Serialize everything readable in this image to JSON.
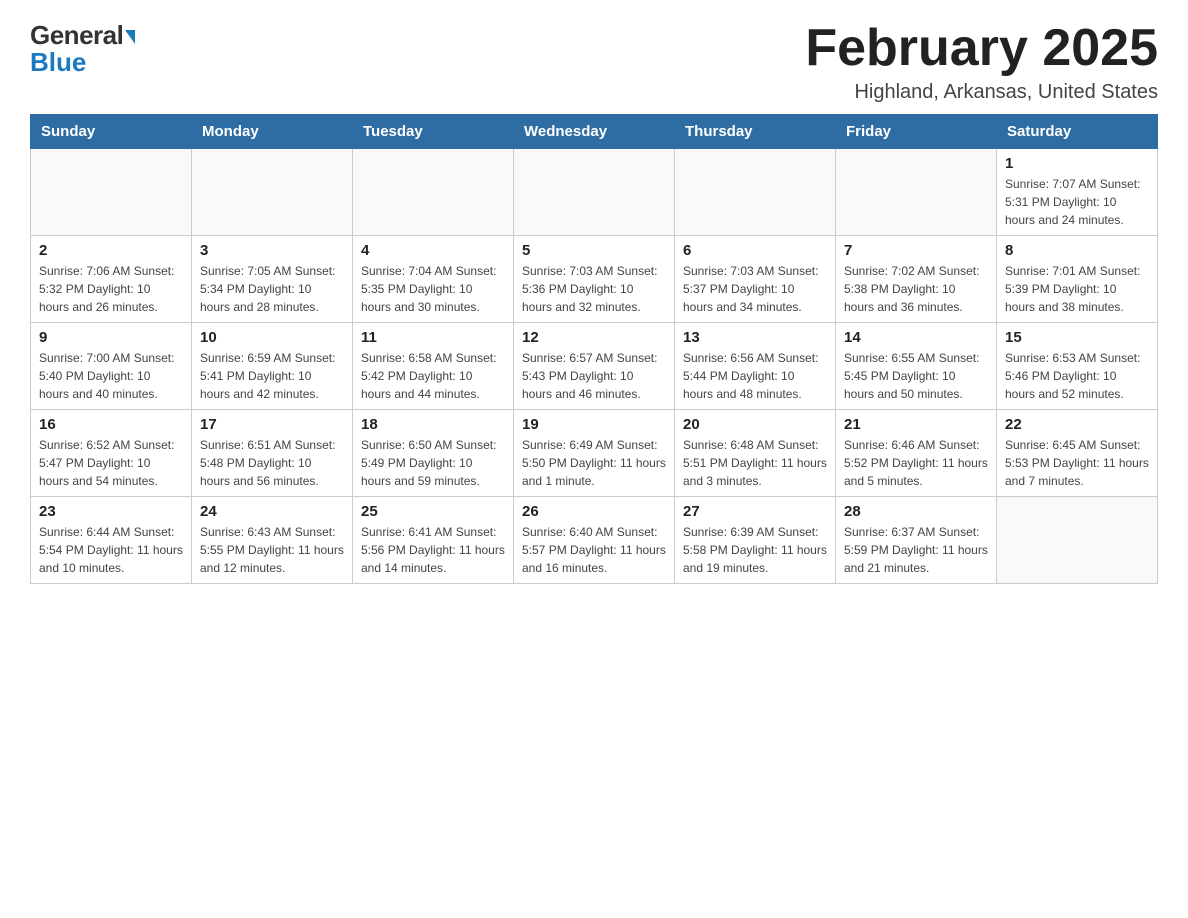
{
  "header": {
    "logo_general": "General",
    "logo_blue": "Blue",
    "month_title": "February 2025",
    "location": "Highland, Arkansas, United States"
  },
  "weekdays": [
    "Sunday",
    "Monday",
    "Tuesday",
    "Wednesday",
    "Thursday",
    "Friday",
    "Saturday"
  ],
  "weeks": [
    [
      {
        "day": "",
        "info": ""
      },
      {
        "day": "",
        "info": ""
      },
      {
        "day": "",
        "info": ""
      },
      {
        "day": "",
        "info": ""
      },
      {
        "day": "",
        "info": ""
      },
      {
        "day": "",
        "info": ""
      },
      {
        "day": "1",
        "info": "Sunrise: 7:07 AM\nSunset: 5:31 PM\nDaylight: 10 hours and 24 minutes."
      }
    ],
    [
      {
        "day": "2",
        "info": "Sunrise: 7:06 AM\nSunset: 5:32 PM\nDaylight: 10 hours and 26 minutes."
      },
      {
        "day": "3",
        "info": "Sunrise: 7:05 AM\nSunset: 5:34 PM\nDaylight: 10 hours and 28 minutes."
      },
      {
        "day": "4",
        "info": "Sunrise: 7:04 AM\nSunset: 5:35 PM\nDaylight: 10 hours and 30 minutes."
      },
      {
        "day": "5",
        "info": "Sunrise: 7:03 AM\nSunset: 5:36 PM\nDaylight: 10 hours and 32 minutes."
      },
      {
        "day": "6",
        "info": "Sunrise: 7:03 AM\nSunset: 5:37 PM\nDaylight: 10 hours and 34 minutes."
      },
      {
        "day": "7",
        "info": "Sunrise: 7:02 AM\nSunset: 5:38 PM\nDaylight: 10 hours and 36 minutes."
      },
      {
        "day": "8",
        "info": "Sunrise: 7:01 AM\nSunset: 5:39 PM\nDaylight: 10 hours and 38 minutes."
      }
    ],
    [
      {
        "day": "9",
        "info": "Sunrise: 7:00 AM\nSunset: 5:40 PM\nDaylight: 10 hours and 40 minutes."
      },
      {
        "day": "10",
        "info": "Sunrise: 6:59 AM\nSunset: 5:41 PM\nDaylight: 10 hours and 42 minutes."
      },
      {
        "day": "11",
        "info": "Sunrise: 6:58 AM\nSunset: 5:42 PM\nDaylight: 10 hours and 44 minutes."
      },
      {
        "day": "12",
        "info": "Sunrise: 6:57 AM\nSunset: 5:43 PM\nDaylight: 10 hours and 46 minutes."
      },
      {
        "day": "13",
        "info": "Sunrise: 6:56 AM\nSunset: 5:44 PM\nDaylight: 10 hours and 48 minutes."
      },
      {
        "day": "14",
        "info": "Sunrise: 6:55 AM\nSunset: 5:45 PM\nDaylight: 10 hours and 50 minutes."
      },
      {
        "day": "15",
        "info": "Sunrise: 6:53 AM\nSunset: 5:46 PM\nDaylight: 10 hours and 52 minutes."
      }
    ],
    [
      {
        "day": "16",
        "info": "Sunrise: 6:52 AM\nSunset: 5:47 PM\nDaylight: 10 hours and 54 minutes."
      },
      {
        "day": "17",
        "info": "Sunrise: 6:51 AM\nSunset: 5:48 PM\nDaylight: 10 hours and 56 minutes."
      },
      {
        "day": "18",
        "info": "Sunrise: 6:50 AM\nSunset: 5:49 PM\nDaylight: 10 hours and 59 minutes."
      },
      {
        "day": "19",
        "info": "Sunrise: 6:49 AM\nSunset: 5:50 PM\nDaylight: 11 hours and 1 minute."
      },
      {
        "day": "20",
        "info": "Sunrise: 6:48 AM\nSunset: 5:51 PM\nDaylight: 11 hours and 3 minutes."
      },
      {
        "day": "21",
        "info": "Sunrise: 6:46 AM\nSunset: 5:52 PM\nDaylight: 11 hours and 5 minutes."
      },
      {
        "day": "22",
        "info": "Sunrise: 6:45 AM\nSunset: 5:53 PM\nDaylight: 11 hours and 7 minutes."
      }
    ],
    [
      {
        "day": "23",
        "info": "Sunrise: 6:44 AM\nSunset: 5:54 PM\nDaylight: 11 hours and 10 minutes."
      },
      {
        "day": "24",
        "info": "Sunrise: 6:43 AM\nSunset: 5:55 PM\nDaylight: 11 hours and 12 minutes."
      },
      {
        "day": "25",
        "info": "Sunrise: 6:41 AM\nSunset: 5:56 PM\nDaylight: 11 hours and 14 minutes."
      },
      {
        "day": "26",
        "info": "Sunrise: 6:40 AM\nSunset: 5:57 PM\nDaylight: 11 hours and 16 minutes."
      },
      {
        "day": "27",
        "info": "Sunrise: 6:39 AM\nSunset: 5:58 PM\nDaylight: 11 hours and 19 minutes."
      },
      {
        "day": "28",
        "info": "Sunrise: 6:37 AM\nSunset: 5:59 PM\nDaylight: 11 hours and 21 minutes."
      },
      {
        "day": "",
        "info": ""
      }
    ]
  ]
}
